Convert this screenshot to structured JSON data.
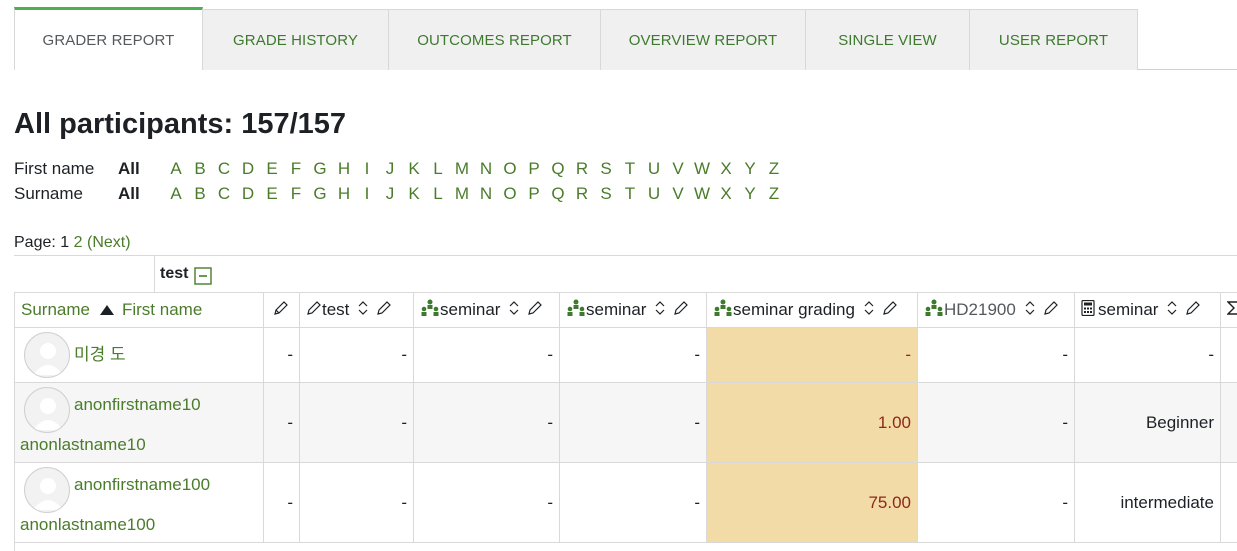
{
  "tabs": [
    "GRADER REPORT",
    "GRADE HISTORY",
    "OUTCOMES REPORT",
    "OVERVIEW REPORT",
    "SINGLE VIEW",
    "USER REPORT"
  ],
  "page_title": "All participants: 157/157",
  "initials_bar": {
    "first_name_label": "First name",
    "surname_label": "Surname",
    "all_label": "All",
    "letters": [
      "A",
      "B",
      "C",
      "D",
      "E",
      "F",
      "G",
      "H",
      "I",
      "J",
      "K",
      "L",
      "M",
      "N",
      "O",
      "P",
      "Q",
      "R",
      "S",
      "T",
      "U",
      "V",
      "W",
      "X",
      "Y",
      "Z"
    ]
  },
  "paging": {
    "label": "Page:",
    "current": "1",
    "next_page": "2",
    "next_label": "(Next)"
  },
  "category": {
    "name": "test"
  },
  "columns": {
    "user": {
      "surname": "Surname",
      "first_name": "First name"
    },
    "items": [
      "test",
      "seminar",
      "seminar",
      "seminar grading",
      "HD21900",
      "seminar"
    ]
  },
  "rows": [
    {
      "name_line1": "미경 도",
      "name_line2": "",
      "values": [
        "-",
        "-",
        "-",
        "-",
        "-",
        "-",
        "-"
      ]
    },
    {
      "name_line1": "anonfirstname10",
      "name_line2": "anonlastname10",
      "values": [
        "-",
        "-",
        "-",
        "-",
        "1.00",
        "-",
        "Beginner"
      ]
    },
    {
      "name_line1": "anonfirstname100",
      "name_line2": "anonlastname100",
      "values": [
        "-",
        "-",
        "-",
        "-",
        "75.00",
        "-",
        "intermediate"
      ]
    }
  ],
  "colors": {
    "accent": "#4caf50",
    "link": "#4a7c2a",
    "highlight": "#f3dba8"
  },
  "icons": [
    "edit-pencil-icon",
    "sort-ascending-icon",
    "sort-toggle-icon",
    "activity-people-icon",
    "calculator-icon",
    "collapse-minus-icon",
    "sum-icon",
    "user-avatar-icon"
  ]
}
